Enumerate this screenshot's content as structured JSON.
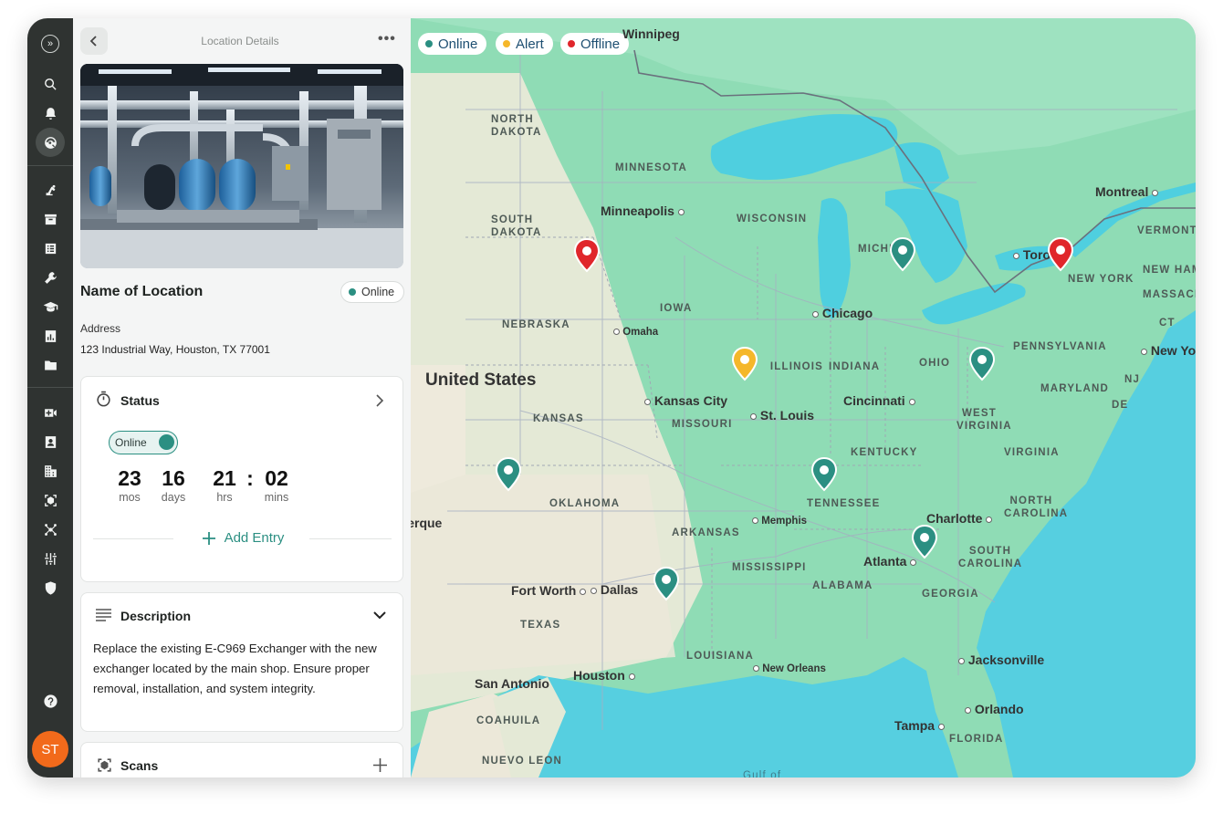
{
  "header": {
    "title": "Location Details",
    "more": "•••"
  },
  "location": {
    "name": "Name of Location",
    "status": "Online",
    "address_label": "Address",
    "address": "123 Industrial Way, Houston, TX 77001"
  },
  "status_card": {
    "title": "Status",
    "toggle": "Online",
    "timer": [
      {
        "value": "23",
        "unit": "mos"
      },
      {
        "value": "16",
        "unit": "days"
      },
      {
        "value": "21",
        "unit": "hrs"
      },
      {
        "value": "02",
        "unit": "mins"
      }
    ],
    "separator": ":",
    "add_entry": "Add Entry"
  },
  "description_card": {
    "title": "Description",
    "text": "Replace the existing E-C969 Exchanger with the new exchanger located by the main shop. Ensure proper removal, installation, and system integrity."
  },
  "scans_card": {
    "title": "Scans"
  },
  "user": {
    "initials": "ST"
  },
  "legend": [
    {
      "label": "Online",
      "color": "#2b8f82"
    },
    {
      "label": "Alert",
      "color": "#f5b72a"
    },
    {
      "label": "Offline",
      "color": "#e0262b"
    }
  ],
  "map": {
    "country": "United States",
    "cities": [
      "Winnipeg",
      "Montreal",
      "Minneapolis",
      "Chicago",
      "Toronto",
      "New York",
      "Omaha",
      "Kansas City",
      "St. Louis",
      "Cincinnati",
      "Memphis",
      "Charlotte",
      "Atlanta",
      "Fort Worth",
      "Dallas",
      "Houston",
      "San Antonio",
      "New Orleans",
      "Jacksonville",
      "Orlando",
      "Tampa",
      "Albuquerque"
    ],
    "states": [
      "NORTH DAKOTA",
      "SOUTH DAKOTA",
      "MINNESOTA",
      "WISCONSIN",
      "MICHIGAN",
      "IOWA",
      "NEBRASKA",
      "ILLINOIS",
      "INDIANA",
      "OHIO",
      "PENNSYLVANIA",
      "NEW YORK",
      "VERMONT",
      "NEW HAMPSHIRE",
      "MASSACHUSETTS",
      "CT",
      "NJ",
      "MARYLAND",
      "DE",
      "WEST VIRGINIA",
      "VIRGINIA",
      "KENTUCKY",
      "TENNESSEE",
      "NORTH CAROLINA",
      "SOUTH CAROLINA",
      "GEORGIA",
      "ALABAMA",
      "MISSISSIPPI",
      "LOUISIANA",
      "ARKANSAS",
      "OKLAHOMA",
      "KANSAS",
      "MISSOURI",
      "TEXAS",
      "FLORIDA",
      "COAHUILA",
      "NUEVO LEON"
    ],
    "water": "Gulf of",
    "markers": [
      {
        "status": "offline",
        "color": "#e0262b"
      },
      {
        "status": "online",
        "color": "#2b8f82"
      },
      {
        "status": "offline",
        "color": "#e0262b"
      },
      {
        "status": "alert",
        "color": "#f5b72a"
      },
      {
        "status": "online",
        "color": "#2b8f82"
      },
      {
        "status": "online",
        "color": "#2b8f82"
      },
      {
        "status": "online",
        "color": "#2b8f82"
      },
      {
        "status": "online",
        "color": "#2b8f82"
      },
      {
        "status": "online",
        "color": "#2b8f82"
      }
    ]
  }
}
